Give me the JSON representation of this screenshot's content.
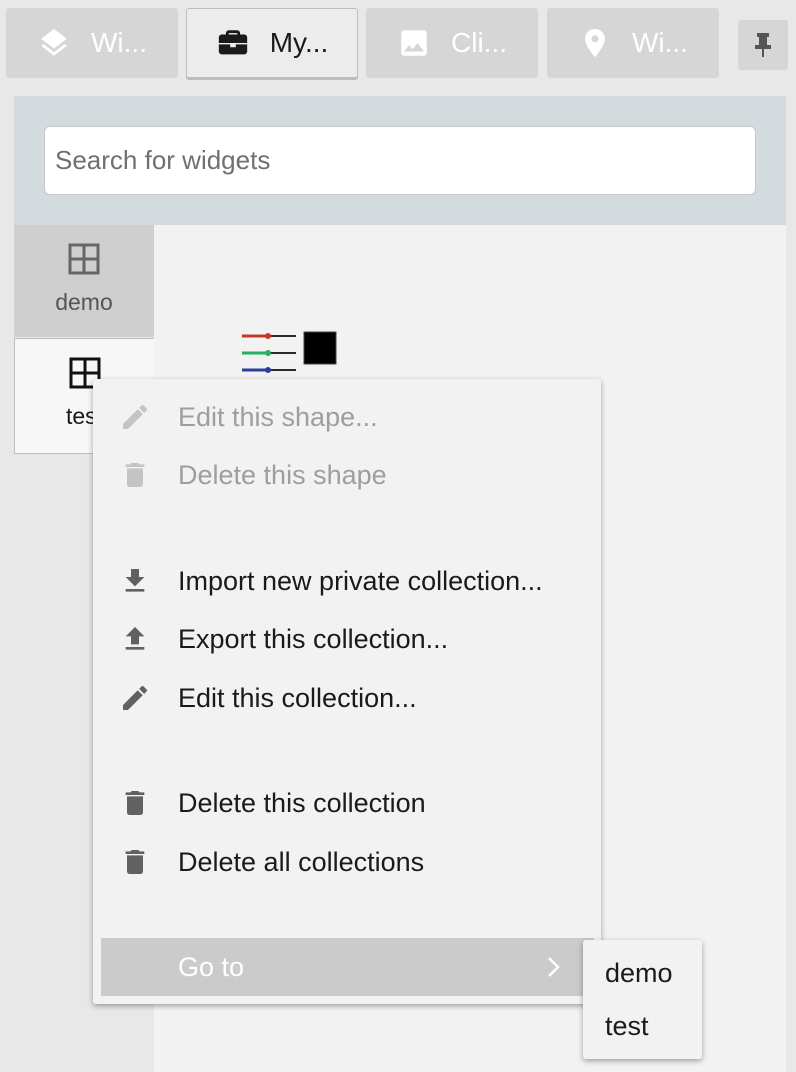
{
  "tabs": [
    {
      "label": "Wi...",
      "icon": "layers-icon",
      "active": false
    },
    {
      "label": "My...",
      "icon": "briefcase-icon",
      "active": true
    },
    {
      "label": "Cli...",
      "icon": "image-icon",
      "active": false
    },
    {
      "label": "Wi...",
      "icon": "map-pin-icon",
      "active": false
    }
  ],
  "pin_icon": "pushpin-icon",
  "search": {
    "placeholder": "Search for widgets",
    "value": ""
  },
  "collections": [
    {
      "label": "demo",
      "icon": "grid-icon",
      "selected": false
    },
    {
      "label": "test",
      "icon": "grid-icon",
      "selected": true
    }
  ],
  "widget": {
    "icon": "rgb-sliders-icon"
  },
  "context_menu": {
    "items": [
      {
        "label": "Edit this shape...",
        "icon": "pencil-icon",
        "disabled": true
      },
      {
        "label": "Delete this shape",
        "icon": "trash-icon",
        "disabled": true
      },
      {
        "label": "Import new private collection...",
        "icon": "download-icon",
        "disabled": false
      },
      {
        "label": "Export this collection...",
        "icon": "upload-icon",
        "disabled": false
      },
      {
        "label": "Edit this collection...",
        "icon": "pencil-icon",
        "disabled": false
      },
      {
        "label": "Delete this collection",
        "icon": "trash-icon",
        "disabled": false
      },
      {
        "label": "Delete all collections",
        "icon": "trash-icon",
        "disabled": false
      }
    ],
    "goto": {
      "label": "Go to",
      "icon": "chevron-right-icon"
    }
  },
  "submenu": {
    "items": [
      "demo",
      "test"
    ]
  },
  "colors": {
    "accent_band": "#d3dbdf",
    "menu_bg": "#f2f2f2",
    "menu_highlight": "#cbcbcb",
    "disabled_text": "#9e9e9e",
    "icon_gray": "#616161"
  }
}
